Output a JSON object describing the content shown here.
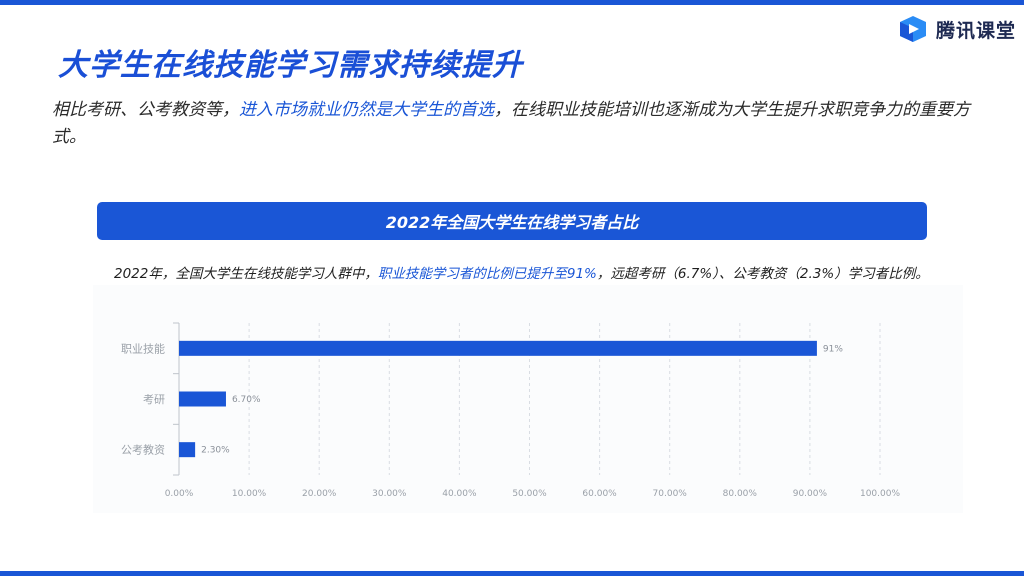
{
  "brand": {
    "name": "腾讯课堂",
    "accent": "#1a56d6",
    "logo_icon": "tencent-classroom-play-icon"
  },
  "title": "大学生在线技能学习需求持续提升",
  "intro": {
    "part1": "相比考研、公考教资等，",
    "highlight": "进入市场就业仍然是大学生的首选",
    "part2": "，在线职业技能培训也逐渐成为大学生提升求职竞争力的重要方式。"
  },
  "banner": "2022年全国大学生在线学习者占比",
  "summary": {
    "part1": "2022年，全国大学生在线技能学习人群中，",
    "highlight": "职业技能学习者的比例已提升至91%",
    "part2": "，远超考研（6.7%）、公考教资（2.3%）学习者比例。"
  },
  "chart_data": {
    "type": "bar",
    "orientation": "horizontal",
    "categories": [
      "职业技能",
      "考研",
      "公考教资"
    ],
    "values": [
      91,
      6.7,
      2.3
    ],
    "value_labels": [
      "91%",
      "6.70%",
      "2.30%"
    ],
    "x_ticks": [
      "0.00%",
      "10.00%",
      "20.00%",
      "30.00%",
      "40.00%",
      "50.00%",
      "60.00%",
      "70.00%",
      "80.00%",
      "90.00%",
      "100.00%"
    ],
    "xlim": [
      0,
      100
    ],
    "grid": true,
    "bar_color": "#1a56d6"
  }
}
